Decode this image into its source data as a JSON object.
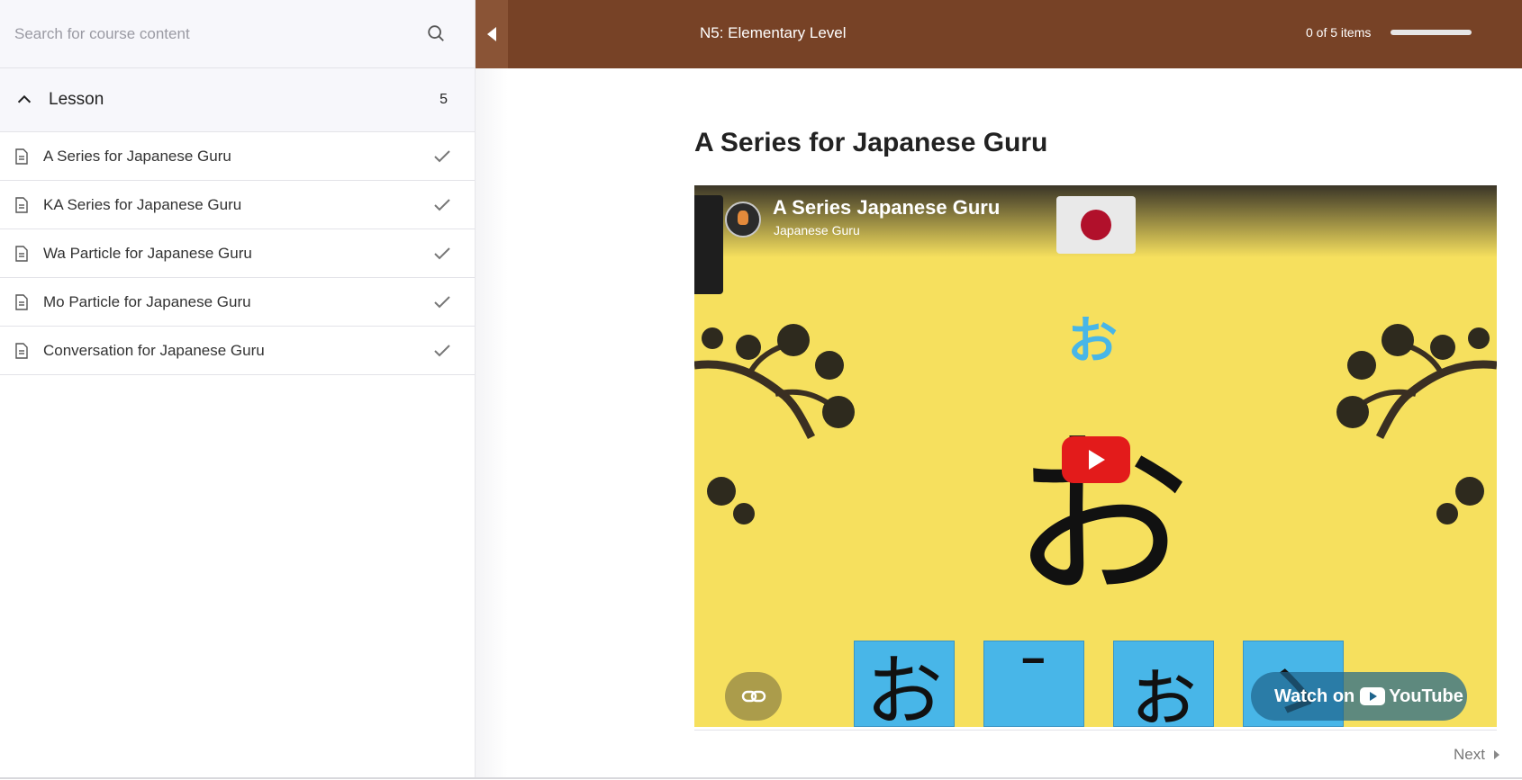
{
  "sidebar": {
    "search_placeholder": "Search for course content",
    "section": {
      "title": "Lesson",
      "count": "5"
    },
    "items": [
      {
        "label": "A Series for Japanese Guru"
      },
      {
        "label": "KA Series for Japanese Guru"
      },
      {
        "label": "Wa Particle for Japanese Guru"
      },
      {
        "label": "Mo Particle for Japanese Guru"
      },
      {
        "label": "Conversation for Japanese Guru"
      }
    ]
  },
  "header": {
    "course_title": "N5: Elementary Level",
    "progress_text": "0 of 5 items",
    "progress_fraction": 0
  },
  "lesson": {
    "title": "A Series for Japanese Guru",
    "video": {
      "title": "A Series Japanese Guru",
      "channel": "Japanese Guru",
      "kana_small": "お",
      "kana_big": "お",
      "tiles": [
        "お",
        "ˉ",
        "ぉ",
        "ゝ"
      ],
      "watch_label": "Watch on",
      "youtube_label": "YouTube"
    }
  },
  "footer": {
    "next_label": "Next"
  },
  "colors": {
    "brand": "#774226",
    "video_bg": "#f6e05e",
    "tile": "#48b6e8",
    "play": "#e31b1b"
  }
}
